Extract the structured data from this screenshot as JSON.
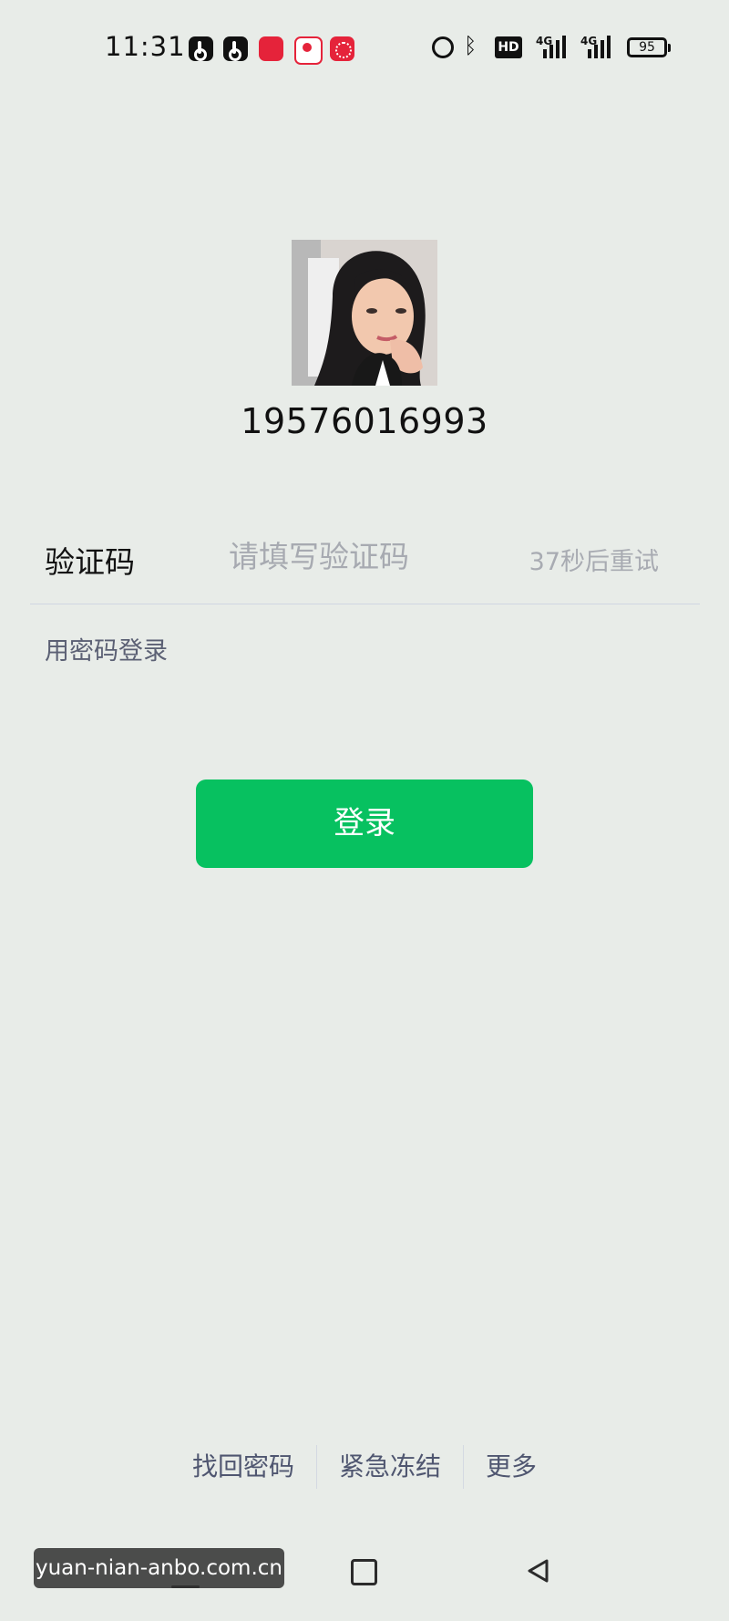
{
  "status_bar": {
    "time": "11:31",
    "battery_level": "95",
    "hd_badge": "HD",
    "network_1": "4G",
    "network_2": "4G",
    "app_icons": [
      "tiktok-icon",
      "tiktok-lite-icon",
      "red-app-icon",
      "video-app-icon",
      "pinduoduo-icon"
    ],
    "system_icons": [
      "alarm-icon",
      "bluetooth-icon",
      "hd-icon",
      "signal-icon",
      "signal-icon",
      "battery-icon"
    ]
  },
  "account": {
    "phone_number": "19576016993"
  },
  "verification": {
    "label": "验证码",
    "placeholder": "请填写验证码",
    "retry_text": "37秒后重试"
  },
  "password_login_link": "用密码登录",
  "login_button": "登录",
  "footer": {
    "links": [
      "找回密码",
      "紧急冻结",
      "更多"
    ]
  },
  "navigation": {
    "buttons": [
      "home-icon",
      "recent-apps-icon",
      "back-icon"
    ]
  },
  "watermark": "yuan-nian-anbo.com.cn",
  "colors": {
    "background": "#e8ece8",
    "primary": "#07c160",
    "link": "#5b6074",
    "placeholder": "#a7aab1"
  }
}
